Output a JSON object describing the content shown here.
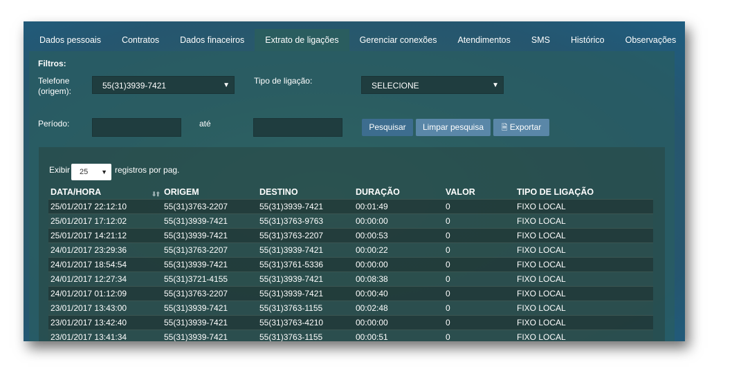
{
  "tabs": [
    {
      "label": "Dados pessoais"
    },
    {
      "label": "Contratos"
    },
    {
      "label": "Dados finaceiros"
    },
    {
      "label": "Extrato de ligações"
    },
    {
      "label": "Gerenciar conexões"
    },
    {
      "label": "Atendimentos"
    },
    {
      "label": "SMS"
    },
    {
      "label": "Histórico"
    },
    {
      "label": "Observações"
    }
  ],
  "filters": {
    "title": "Filtros:",
    "phone_label_1": "Telefone",
    "phone_label_2": "(origem):",
    "phone_value": "55(31)3939-7421",
    "call_type_label": "Tipo de ligação:",
    "call_type_value": "SELECIONE",
    "period_label": "Período:",
    "until_label": "até",
    "search_button": "Pesquisar",
    "clear_button": "Limpar pesquisa",
    "export_button": "Exportar"
  },
  "table": {
    "show_label": "Exibir",
    "page_size": "25",
    "per_page_label": "registros por pag.",
    "columns": [
      "DATA/HORA",
      "ORIGEM",
      "DESTINO",
      "DURAÇÃO",
      "VALOR",
      "TIPO DE LIGAÇÃO"
    ],
    "rows": [
      [
        "25/01/2017 22:12:10",
        "55(31)3763-2207",
        "55(31)3939-7421",
        "00:01:49",
        "0",
        "FIXO LOCAL"
      ],
      [
        "25/01/2017 17:12:02",
        "55(31)3939-7421",
        "55(31)3763-9763",
        "00:00:00",
        "0",
        "FIXO LOCAL"
      ],
      [
        "25/01/2017 14:21:12",
        "55(31)3939-7421",
        "55(31)3763-2207",
        "00:00:53",
        "0",
        "FIXO LOCAL"
      ],
      [
        "24/01/2017 23:29:36",
        "55(31)3763-2207",
        "55(31)3939-7421",
        "00:00:22",
        "0",
        "FIXO LOCAL"
      ],
      [
        "24/01/2017 18:54:54",
        "55(31)3939-7421",
        "55(31)3761-5336",
        "00:00:00",
        "0",
        "FIXO LOCAL"
      ],
      [
        "24/01/2017 12:27:34",
        "55(31)3721-4155",
        "55(31)3939-7421",
        "00:08:38",
        "0",
        "FIXO LOCAL"
      ],
      [
        "24/01/2017 01:12:09",
        "55(31)3763-2207",
        "55(31)3939-7421",
        "00:00:40",
        "0",
        "FIXO LOCAL"
      ],
      [
        "23/01/2017 13:43:00",
        "55(31)3939-7421",
        "55(31)3763-1155",
        "00:02:48",
        "0",
        "FIXO LOCAL"
      ],
      [
        "23/01/2017 13:42:40",
        "55(31)3939-7421",
        "55(31)3763-4210",
        "00:00:00",
        "0",
        "FIXO LOCAL"
      ],
      [
        "23/01/2017 13:41:34",
        "55(31)3939-7421",
        "55(31)3763-1155",
        "00:00:51",
        "0",
        "FIXO LOCAL"
      ]
    ]
  }
}
